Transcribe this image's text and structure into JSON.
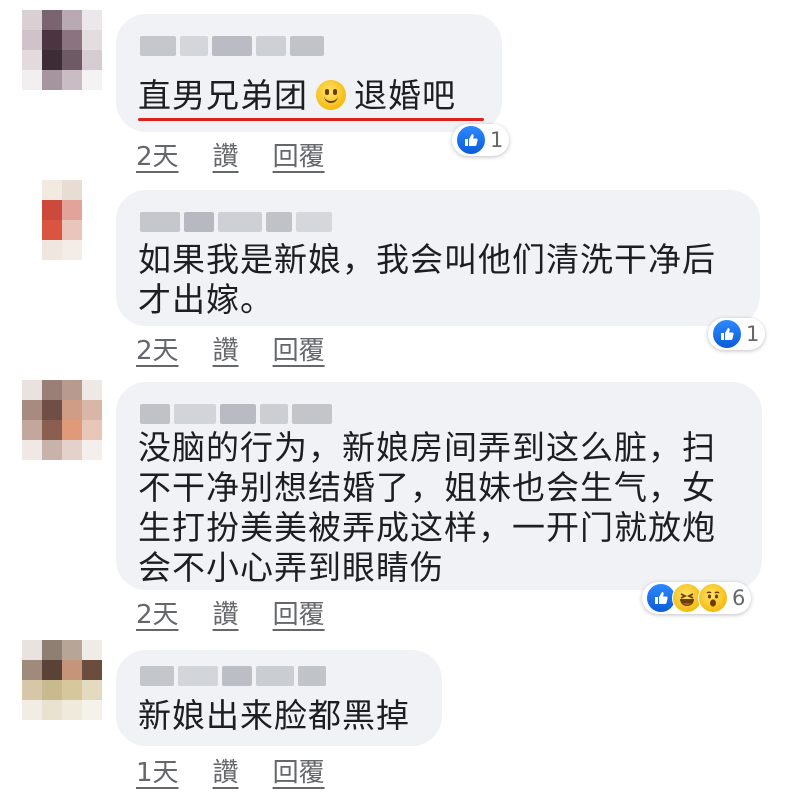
{
  "actions": {
    "like_label": "讚",
    "reply_label": "回覆"
  },
  "comments": [
    {
      "text_before": "直男兄弟团",
      "emoji": "slightly-smiling-face-icon",
      "text_after": "退婚吧",
      "time": "2天",
      "reactions": [
        "like-reaction-icon"
      ],
      "reaction_count": "1"
    },
    {
      "text": "如果我是新娘，我会叫他们清洗干净后\n才出嫁。",
      "time": "2天",
      "reactions": [
        "like-reaction-icon"
      ],
      "reaction_count": "1"
    },
    {
      "text": "没脑的行为，新娘房间弄到这么脏，扫\n不干净别想结婚了，姐妹也会生气，女\n生打扮美美被弄成这样，一开门就放炮\n会不小心弄到眼睛伤",
      "time": "2天",
      "reactions": [
        "like-reaction-icon",
        "haha-reaction-icon",
        "wow-reaction-icon"
      ],
      "reaction_count": "6"
    },
    {
      "text": "新娘出来脸都黑掉",
      "time": "1天",
      "reactions": [],
      "reaction_count": ""
    }
  ],
  "colors": {
    "bubble": "#f0f2f5",
    "meta_text": "#65676b",
    "underline_mark": "#e0201b",
    "like_blue": "#1877f2"
  }
}
